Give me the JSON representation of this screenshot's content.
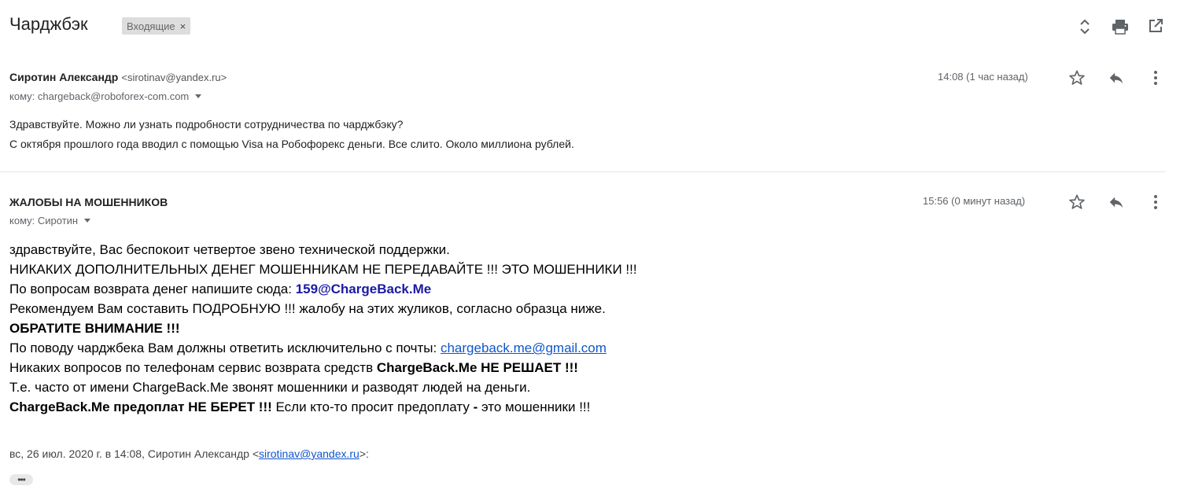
{
  "thread": {
    "subject": "Чарджбэк",
    "label": "Входящие",
    "label_remove": "×"
  },
  "toolbar_icons": [
    "expand-collapse-icon",
    "print-icon",
    "open-in-new-window-icon"
  ],
  "message1": {
    "sender_name": "Сиротин Александр",
    "sender_email": "<sirotinav@yandex.ru>",
    "recipient": "кому: chargeback@roboforex-com.com",
    "time": "14:08 (1 час назад)",
    "body": [
      "Здравствуйте. Можно ли узнать подробности сотрудничества по чарджбэку?",
      "С октября прошлого года вводил с помощью Visa на Робофорекс деньги. Все слито. Около миллиона рублей."
    ]
  },
  "message2": {
    "sender_name": "ЖАЛОБЫ НА МОШЕННИКОВ",
    "recipient": "кому: Сиротин",
    "time": "15:56 (0 минут назад)",
    "body": {
      "l1": "здравствуйте, Вас беспокоит четвертое звено технической поддержки.",
      "l2": "НИКАКИХ ДОПОЛНИТЕЛЬНЫХ ДЕНЕГ МОШЕННИКАМ НЕ ПЕРЕДАВАЙТЕ !!! ЭТО МОШЕННИКИ !!!",
      "l3_text": "По вопросам возврата денег напишите сюда: ",
      "l3_email": "159@ChargeBack.Me",
      "l4": "Рекомендуем Вам составить ПОДРОБНУЮ !!! жалобу на этих жуликов, согласно образца ниже.",
      "l5": "ОБРАТИТЕ ВНИМАНИЕ !!!",
      "l6_text": "По поводу чарджбека Вам должны ответить исключительно с почты: ",
      "l6_link": "chargeback.me@gmail.com",
      "l7_text": "Никаких вопросов по телефонам сервис возврата средств ",
      "l7_bold": "ChargeBack.Me НЕ РЕШАЕТ !!!",
      "l8": "Т.е. часто от имени ChargeBack.Me звонят мошенники и разводят людей на деньги.",
      "l9_bold": "ChargeBack.Me предоплат НЕ БЕРЕТ !!!",
      "l9_text": " Если кто-то просит предоплату ",
      "l9_dash": "-",
      "l9_end": " это мошенники !!!"
    },
    "quote": {
      "prefix": "вс, 26 июл. 2020 г. в 14:08, Сиротин Александр <",
      "email": "sirotinav@yandex.ru",
      "suffix": ">:"
    },
    "show_trimmed": "•••"
  }
}
